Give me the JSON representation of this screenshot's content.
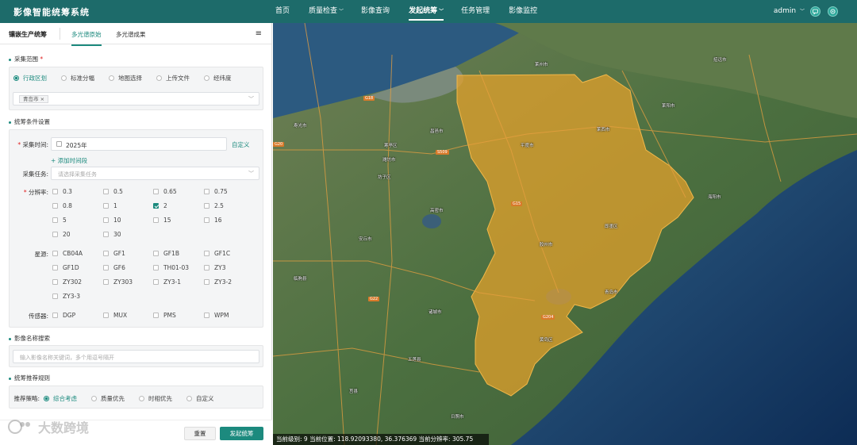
{
  "app": {
    "title": "影像智能统筹系统"
  },
  "nav": [
    {
      "label": "首页",
      "caret": ""
    },
    {
      "label": "质量检查",
      "caret": "﹀"
    },
    {
      "label": "影像查询",
      "caret": ""
    },
    {
      "label": "发起统筹",
      "caret": "﹀"
    },
    {
      "label": "任务管理",
      "caret": ""
    },
    {
      "label": "影像监控",
      "caret": ""
    }
  ],
  "user": {
    "name": "admin",
    "caret": "﹀"
  },
  "panel": {
    "title": "镶嵌生产统筹",
    "tabs": [
      "多光谱原始",
      "多光谱成果"
    ],
    "collection_range": {
      "title": "采集范围",
      "required_mark": "*",
      "options": [
        "行政区划",
        "标准分幅",
        "地图选择",
        "上传文件",
        "经纬度"
      ],
      "selected": "行政区划",
      "region_tag": "青岛市",
      "tag_close": "×"
    },
    "conditions": {
      "title": "统筹条件设置",
      "time_label": "采集时间:",
      "time_value": "2025年",
      "custom_link": "自定义",
      "add_time_link": "+ 添加时间段",
      "task_label": "采集任务:",
      "task_placeholder": "请选择采集任务",
      "resolution_label": "分辨率:",
      "resolutions": [
        "0.3",
        "0.5",
        "0.65",
        "0.75",
        "0.8",
        "1",
        "2",
        "2.5",
        "5",
        "10",
        "15",
        "16",
        "20",
        "30"
      ],
      "resolution_checked": "2",
      "satellite_label": "星源:",
      "satellites": [
        "CB04A",
        "GF1",
        "GF1B",
        "GF1C",
        "GF1D",
        "GF6",
        "TH01-03",
        "ZY3",
        "ZY302",
        "ZY303",
        "ZY3-1",
        "ZY3-2",
        "ZY3-3"
      ],
      "sensor_label": "传感器:",
      "sensors": [
        "DGP",
        "MUX",
        "PMS",
        "WPM"
      ]
    },
    "image_search": {
      "title": "影像名称搜索",
      "placeholder": "输入影像名称关键词，多个用逗号隔开"
    },
    "rules": {
      "title": "统筹推荐规则",
      "strategy_label": "推荐策略:",
      "options": [
        "综合考虑",
        "质量优先",
        "时相优先",
        "自定义"
      ],
      "selected": "综合考虑"
    },
    "buttons": {
      "reset": "重置",
      "submit": "发起统筹"
    },
    "watermark": "大数跨境"
  },
  "map": {
    "status": "当前级别: 9  当前位置: 118.92093380, 36.376369  当前分辨率: 305.75",
    "highlight_color": "#e8a229",
    "labels": [
      {
        "text": "潍坊市",
        "cls": "city"
      },
      {
        "text": "寒亭区",
        "cls": ""
      },
      {
        "text": "坊子区",
        "cls": ""
      },
      {
        "text": "安丘市",
        "cls": ""
      },
      {
        "text": "昌邑市",
        "cls": ""
      },
      {
        "text": "高密市",
        "cls": ""
      },
      {
        "text": "诸城市",
        "cls": ""
      },
      {
        "text": "平度市",
        "cls": ""
      },
      {
        "text": "莱西市",
        "cls": ""
      },
      {
        "text": "即墨区",
        "cls": ""
      },
      {
        "text": "胶州市",
        "cls": ""
      },
      {
        "text": "黄岛区",
        "cls": ""
      },
      {
        "text": "青岛市",
        "cls": "city"
      },
      {
        "text": "莱阳市",
        "cls": ""
      },
      {
        "text": "海阳市",
        "cls": ""
      },
      {
        "text": "五莲县",
        "cls": ""
      },
      {
        "text": "寿光市",
        "cls": ""
      },
      {
        "text": "临朐县",
        "cls": ""
      },
      {
        "text": "莱州市",
        "cls": ""
      },
      {
        "text": "招远市",
        "cls": ""
      },
      {
        "text": "日照市",
        "cls": ""
      },
      {
        "text": "莒县",
        "cls": ""
      }
    ],
    "roads": [
      "G18",
      "S509",
      "G15",
      "G22",
      "G20",
      "G204"
    ]
  }
}
